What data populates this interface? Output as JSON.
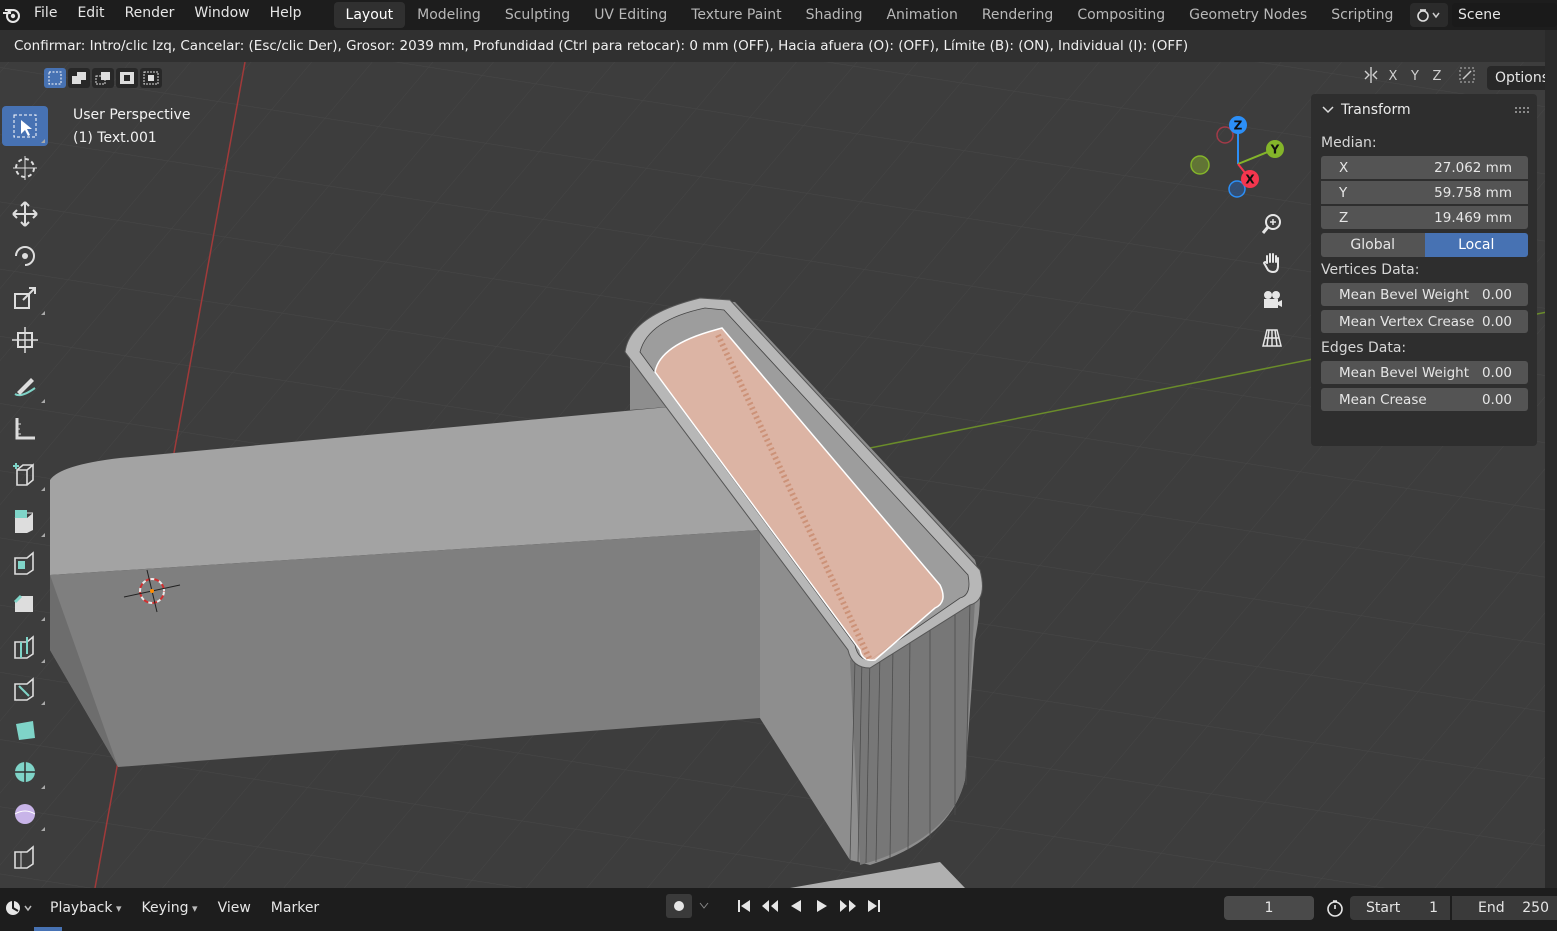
{
  "menu": {
    "items": [
      "File",
      "Edit",
      "Render",
      "Window",
      "Help"
    ]
  },
  "workspaces": {
    "tabs": [
      "Layout",
      "Modeling",
      "Sculpting",
      "UV Editing",
      "Texture Paint",
      "Shading",
      "Animation",
      "Rendering",
      "Compositing",
      "Geometry Nodes",
      "Scripting"
    ],
    "active": "Layout"
  },
  "scene": {
    "name": "Scene"
  },
  "status_line": "Confirmar: Intro/clic Izq, Cancelar: (Esc/clic Der), Grosor: 2039 mm, Profundidad (Ctrl para retocar): 0 mm (OFF), Hacia afuera (O): (OFF), Límite (B): (ON), Individual (I): (OFF)",
  "viewport": {
    "perspective": "User Perspective",
    "object": "(1) Text.001",
    "axis_lock": [
      "X",
      "Y",
      "Z"
    ],
    "options_label": "Options"
  },
  "gizmo": {
    "x_label": "X",
    "y_label": "Y",
    "z_label": "Z"
  },
  "npanel": {
    "title": "Transform",
    "median_label": "Median:",
    "x_label": "X",
    "x_value": "27.062 mm",
    "y_label": "Y",
    "y_value": "59.758 mm",
    "z_label": "Z",
    "z_value": "19.469 mm",
    "global_label": "Global",
    "local_label": "Local",
    "vertices_label": "Vertices Data:",
    "v_bevel_label": "Mean Bevel Weight",
    "v_bevel_value": "0.00",
    "v_crease_label": "Mean Vertex Crease",
    "v_crease_value": "0.00",
    "edges_label": "Edges Data:",
    "e_bevel_label": "Mean Bevel Weight",
    "e_bevel_value": "0.00",
    "e_crease_label": "Mean Crease",
    "e_crease_value": "0.00"
  },
  "timeline": {
    "playback": "Playback",
    "keying": "Keying",
    "view": "View",
    "marker": "Marker",
    "current_frame": "1",
    "start_label": "Start",
    "start_value": "1",
    "end_label": "End",
    "end_value": "250"
  },
  "colors": {
    "accent": "#4772b3",
    "x_axis": "#f5364e",
    "y_axis": "#84b52a",
    "z_axis": "#2c8ff7",
    "selection_face": "#e7b8a6"
  }
}
